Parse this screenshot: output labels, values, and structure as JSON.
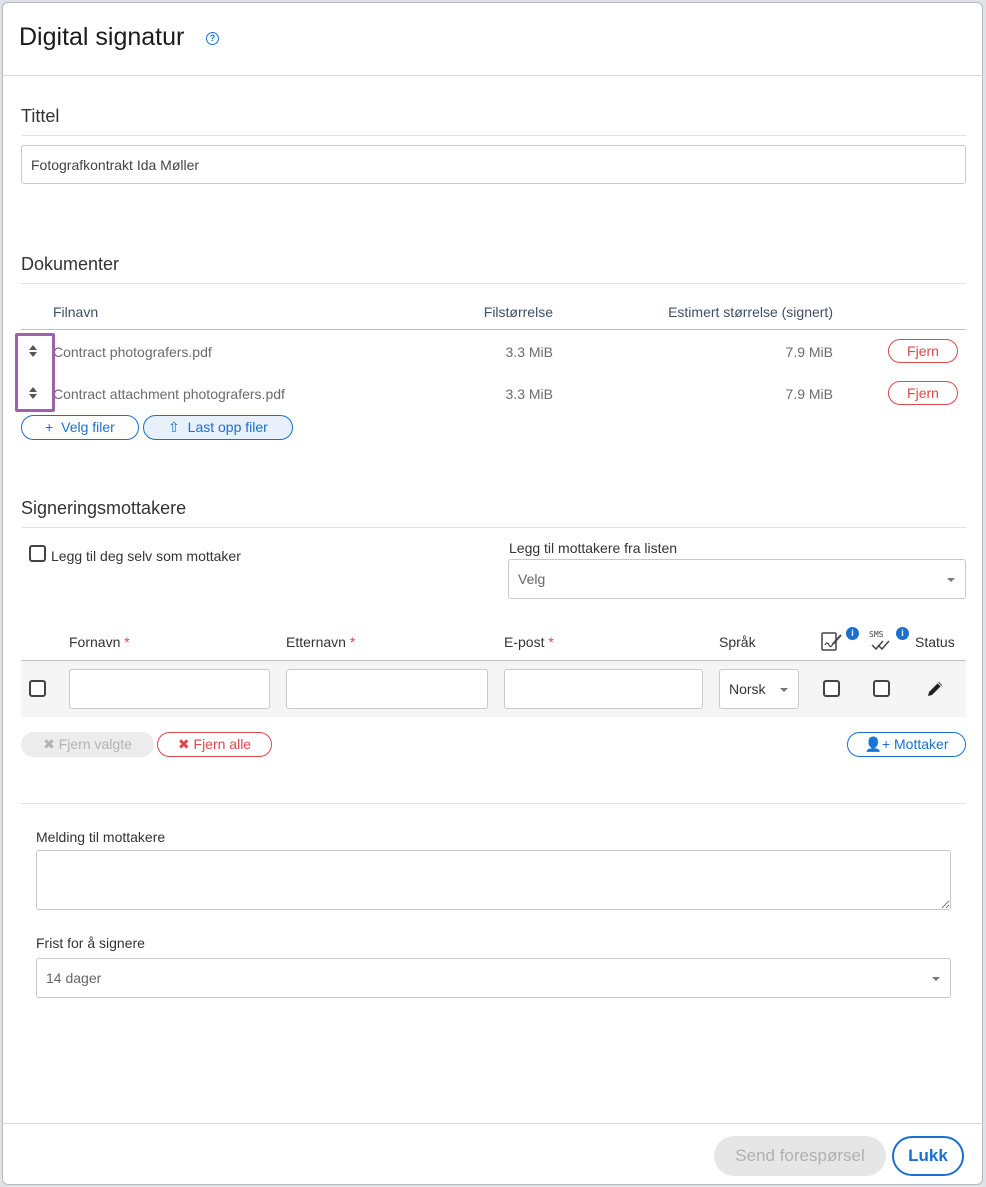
{
  "dialog": {
    "title": "Digital signatur",
    "help_icon": "?"
  },
  "title_section": {
    "heading": "Tittel",
    "value": "Fotografkontrakt Ida Møller"
  },
  "documents": {
    "heading": "Dokumenter",
    "columns": {
      "filename": "Filnavn",
      "filesize": "Filstørrelse",
      "estimated": "Estimert størrelse (signert)"
    },
    "rows": [
      {
        "name": "Contract photografers.pdf",
        "size": "3.3 MiB",
        "estimated": "7.9 MiB",
        "remove": "Fjern"
      },
      {
        "name": "Contract attachment photografers.pdf",
        "size": "3.3 MiB",
        "estimated": "7.9 MiB",
        "remove": "Fjern"
      }
    ],
    "choose_files": "Velg filer",
    "upload_files": "Last opp filer"
  },
  "recipients": {
    "heading": "Signeringsmottakere",
    "add_self": "Legg til deg selv som mottaker",
    "add_from_list_label": "Legg til mottakere fra listen",
    "add_from_list_value": "Velg",
    "columns": {
      "firstname": "Fornavn",
      "lastname": "Etternavn",
      "email": "E-post",
      "language": "Språk",
      "sms": "SMS",
      "status": "Status"
    },
    "required_mark": "*",
    "info_mark": "i",
    "row": {
      "language": "Norsk"
    },
    "remove_selected": "Fjern valgte",
    "remove_all": "Fjern alle",
    "add_recipient": "Mottaker"
  },
  "message": {
    "label": "Melding til mottakere",
    "value": ""
  },
  "deadline": {
    "label": "Frist for å signere",
    "value": "14 dager"
  },
  "footer": {
    "send": "Send forespørsel",
    "close": "Lukk"
  },
  "colors": {
    "accent": "#1a6fd1",
    "danger": "#e0474c",
    "highlight": "#9c63a8"
  }
}
